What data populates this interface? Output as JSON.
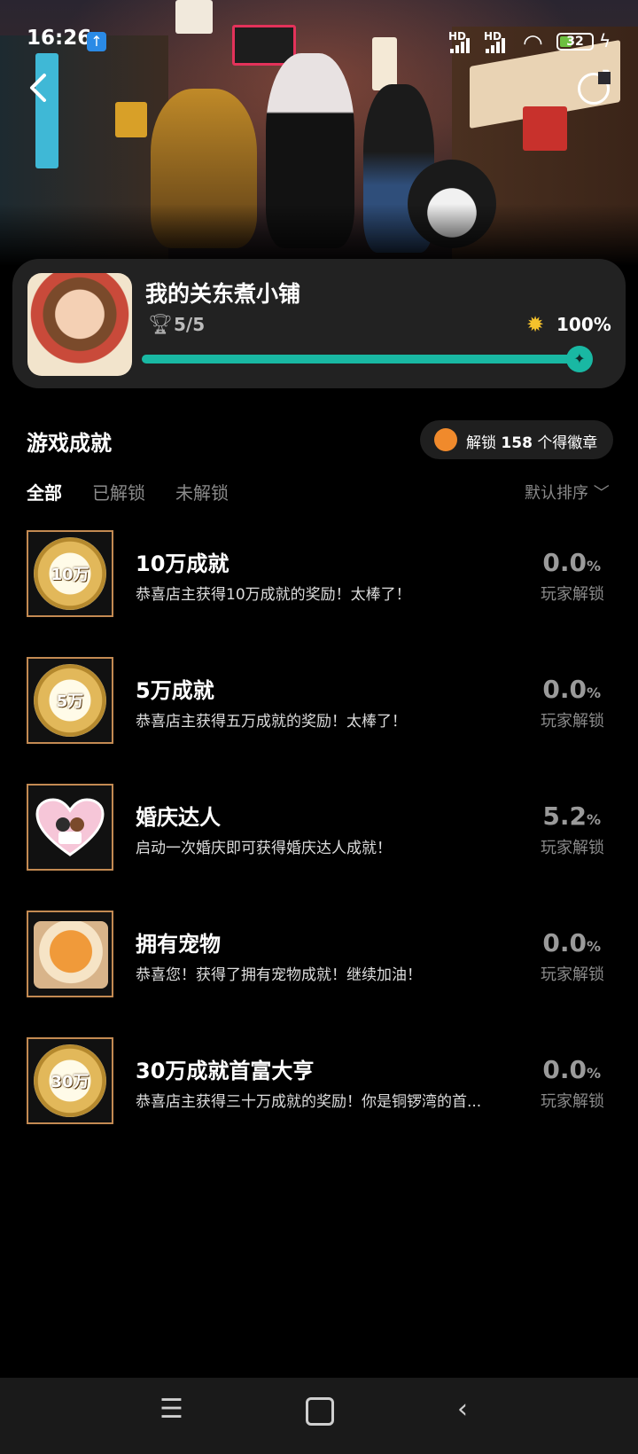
{
  "status_bar": {
    "time": "16:26",
    "signal1": "HD",
    "signal2": "HD",
    "battery": "32"
  },
  "game": {
    "title": "我的关东煮小铺",
    "achievements_progress": "5/5",
    "completion_percent": "100%",
    "progress_fraction": 1.0,
    "accent_color": "#19b8a3"
  },
  "section": {
    "title": "游戏成就",
    "unlock_prefix": "解锁",
    "unlock_count": "158",
    "unlock_suffix": "个得徽章"
  },
  "tabs": [
    {
      "label": "全部",
      "active": true
    },
    {
      "label": "已解锁",
      "active": false
    },
    {
      "label": "未解锁",
      "active": false
    }
  ],
  "sort_label": "默认排序",
  "achievements": [
    {
      "badge_text": "10万",
      "badge_icon": "coin-badge-icon",
      "title": "10万成就",
      "desc": "恭喜店主获得10万成就的奖励！太棒了！",
      "rate": "0.0",
      "unit": "%",
      "rate_label": "玩家解锁"
    },
    {
      "badge_text": "5万",
      "badge_icon": "coin-badge-icon",
      "title": "5万成就",
      "desc": "恭喜店主获得五万成就的奖励！太棒了！",
      "rate": "0.0",
      "unit": "%",
      "rate_label": "玩家解锁"
    },
    {
      "badge_text": "",
      "badge_icon": "wedding-heart-icon",
      "title": "婚庆达人",
      "desc": "启动一次婚庆即可获得婚庆达人成就！",
      "rate": "5.2",
      "unit": "%",
      "rate_label": "玩家解锁"
    },
    {
      "badge_text": "",
      "badge_icon": "pet-cat-icon",
      "title": "拥有宠物",
      "desc": "恭喜您！获得了拥有宠物成就！继续加油！",
      "rate": "0.0",
      "unit": "%",
      "rate_label": "玩家解锁"
    },
    {
      "badge_text": "30万",
      "badge_icon": "coin-badge-icon",
      "title": "30万成就首富大亨",
      "desc": "恭喜店主获得三十万成就的奖励！你是铜锣湾的首...",
      "rate": "0.0",
      "unit": "%",
      "rate_label": "玩家解锁"
    }
  ]
}
